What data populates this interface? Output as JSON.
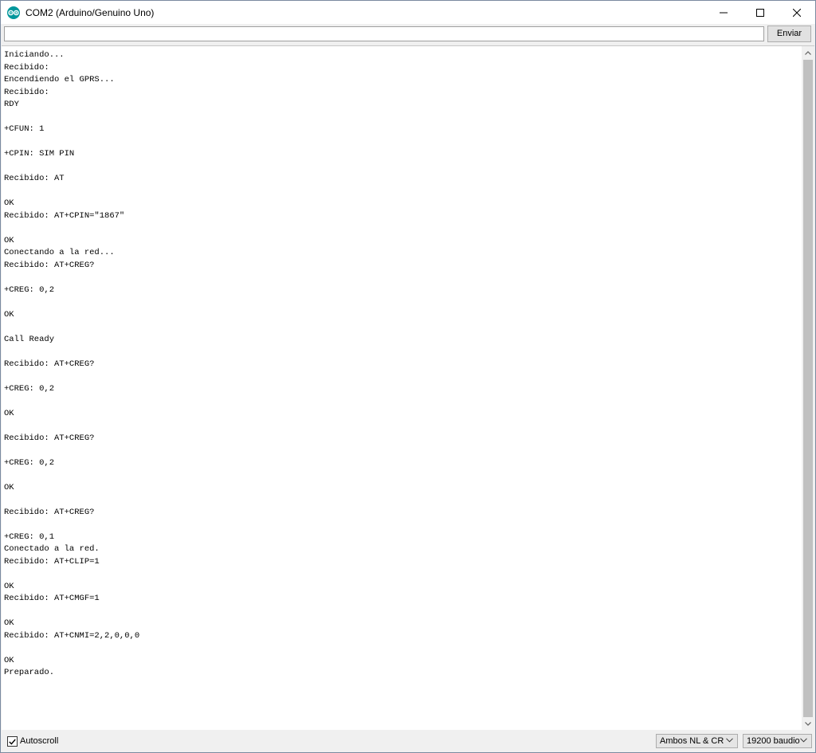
{
  "window": {
    "title": "COM2 (Arduino/Genuino Uno)",
    "controls": {
      "minimize": "—",
      "maximize": "☐",
      "close": "✕"
    }
  },
  "send_row": {
    "input_value": "",
    "send_label": "Enviar"
  },
  "output": {
    "lines": [
      "Iniciando...",
      "Recibido: ",
      "Encendiendo el GPRS...",
      "Recibido: ",
      "RDY",
      "",
      "+CFUN: 1",
      "",
      "+CPIN: SIM PIN",
      "",
      "Recibido: AT",
      "",
      "OK",
      "Recibido: AT+CPIN=\"1867\"",
      "",
      "OK",
      "Conectando a la red...",
      "Recibido: AT+CREG?",
      "",
      "+CREG: 0,2",
      "",
      "OK",
      "",
      "Call Ready",
      "",
      "Recibido: AT+CREG?",
      "",
      "+CREG: 0,2",
      "",
      "OK",
      "",
      "Recibido: AT+CREG?",
      "",
      "+CREG: 0,2",
      "",
      "OK",
      "",
      "Recibido: AT+CREG?",
      "",
      "+CREG: 0,1",
      "Conectado a la red.",
      "Recibido: AT+CLIP=1",
      "",
      "OK",
      "Recibido: AT+CMGF=1",
      "",
      "OK",
      "Recibido: AT+CNMI=2,2,0,0,0",
      "",
      "OK",
      "Preparado."
    ]
  },
  "bottom_bar": {
    "autoscroll_label": "Autoscroll",
    "autoscroll_checked": true,
    "line_ending_selected": "Ambos NL & CR",
    "baud_rate_selected": "19200 baudio"
  },
  "colors": {
    "arduino_teal": "#00979c",
    "scroll_thumb": "#c0c0c0",
    "chrome_bg": "#f0f0f0"
  },
  "icons": {
    "app": "arduino-infinity-icon",
    "scroll_up": "chevron-up-icon",
    "scroll_down": "chevron-down-icon",
    "dropdown": "chevron-down-icon",
    "check": "checkmark-icon"
  }
}
